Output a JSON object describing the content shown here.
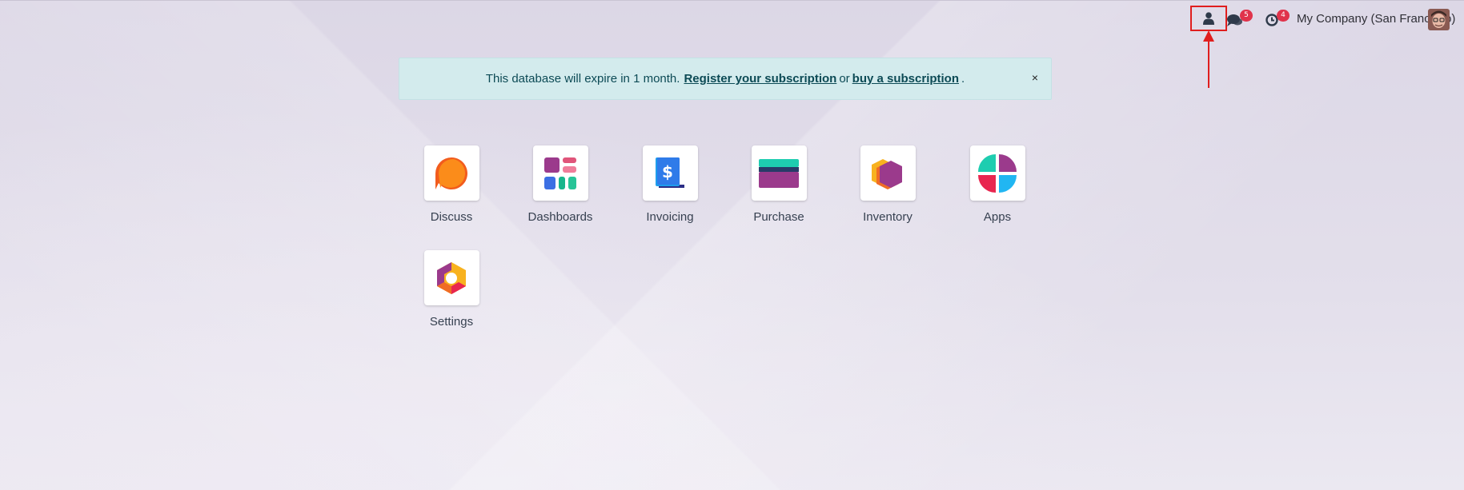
{
  "systray": {
    "chat_count": "5",
    "activity_count": "4",
    "company": "My Company (San Francisco)"
  },
  "banner": {
    "pre_text": "This database will expire in 1 month.",
    "register_link": "Register your subscription",
    "mid_text": "or",
    "buy_link": "buy a subscription",
    "end_text": ".",
    "close_label": "×"
  },
  "apps": [
    {
      "label": "Discuss",
      "icon": "discuss-icon"
    },
    {
      "label": "Dashboards",
      "icon": "dashboards-icon"
    },
    {
      "label": "Invoicing",
      "icon": "invoicing-icon"
    },
    {
      "label": "Purchase",
      "icon": "purchase-icon"
    },
    {
      "label": "Inventory",
      "icon": "inventory-icon"
    },
    {
      "label": "Apps",
      "icon": "apps-icon"
    },
    {
      "label": "Settings",
      "icon": "settings-icon"
    }
  ],
  "colors": {
    "highlight": "#e01e1e",
    "badge": "#e0334b",
    "banner_bg": "#d3ebed"
  }
}
